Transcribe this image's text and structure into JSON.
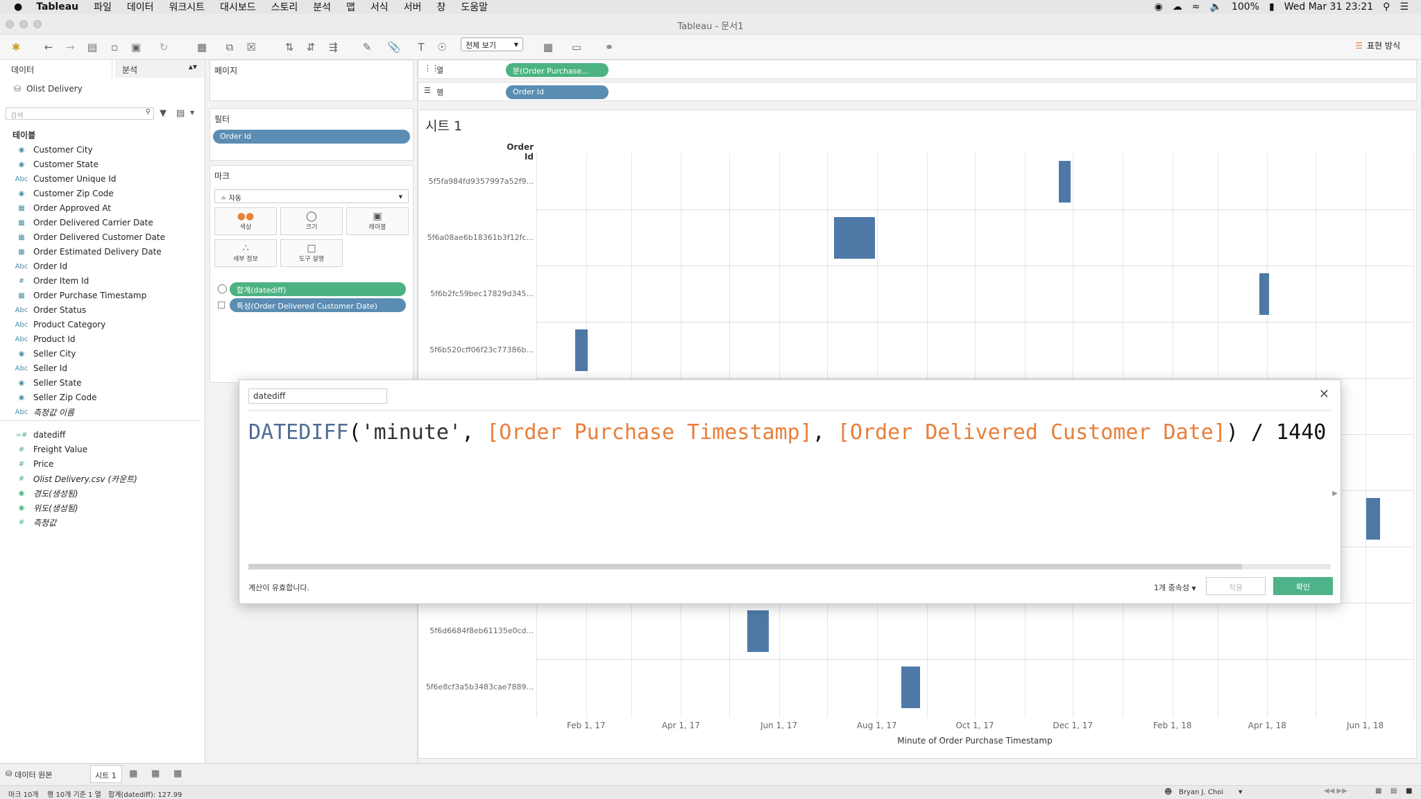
{
  "menubar": {
    "app": "Tableau",
    "items": [
      "파일",
      "데이터",
      "워크시트",
      "대시보드",
      "스토리",
      "분석",
      "맵",
      "서식",
      "서버",
      "창",
      "도움말"
    ],
    "battery": "100%",
    "datetime": "Wed Mar 31  23:21"
  },
  "window": {
    "title": "Tableau - 문서1"
  },
  "toolbar": {
    "view_mode": "전체 보기",
    "show_me": "표현 방식"
  },
  "data_pane": {
    "tab_data": "데이터",
    "tab_analysis": "분석",
    "datasource": "Olist Delivery",
    "search_placeholder": "검색",
    "section": "테이블",
    "dimensions": [
      {
        "icon": "globe",
        "name": "Customer City"
      },
      {
        "icon": "globe",
        "name": "Customer State"
      },
      {
        "icon": "abc",
        "name": "Customer Unique Id"
      },
      {
        "icon": "globe",
        "name": "Customer Zip Code"
      },
      {
        "icon": "date",
        "name": "Order Approved At"
      },
      {
        "icon": "date",
        "name": "Order Delivered Carrier Date"
      },
      {
        "icon": "date",
        "name": "Order Delivered Customer Date"
      },
      {
        "icon": "date",
        "name": "Order Estimated Delivery Date"
      },
      {
        "icon": "abc",
        "name": "Order Id"
      },
      {
        "icon": "hash",
        "name": "Order Item Id"
      },
      {
        "icon": "date",
        "name": "Order Purchase Timestamp"
      },
      {
        "icon": "abc",
        "name": "Order Status"
      },
      {
        "icon": "abc",
        "name": "Product Category"
      },
      {
        "icon": "abc",
        "name": "Product Id"
      },
      {
        "icon": "globe",
        "name": "Seller City"
      },
      {
        "icon": "abc",
        "name": "Seller Id"
      },
      {
        "icon": "globe",
        "name": "Seller State"
      },
      {
        "icon": "globe",
        "name": "Seller Zip Code"
      },
      {
        "icon": "abc",
        "name": "측정값 이름",
        "italic": true
      }
    ],
    "measures": [
      {
        "icon": "calc",
        "name": "datediff"
      },
      {
        "icon": "hash",
        "name": "Freight Value"
      },
      {
        "icon": "hash",
        "name": "Price"
      },
      {
        "icon": "hash",
        "name": "Olist Delivery.csv (카운트)",
        "italic": true
      },
      {
        "icon": "globe",
        "name": "경도(생성됨)",
        "italic": true
      },
      {
        "icon": "globe",
        "name": "위도(생성됨)",
        "italic": true
      },
      {
        "icon": "hash",
        "name": "측정값",
        "italic": true
      }
    ]
  },
  "shelves": {
    "pages_title": "페이지",
    "filters_title": "필터",
    "filter_pill": "Order Id",
    "marks_title": "마크",
    "marks_type": "자동",
    "mark_buttons": [
      "색상",
      "크기",
      "레이블",
      "세부 정보",
      "도구 설명"
    ],
    "mark_pills": [
      "합계(datediff)",
      "특성(Order Delivered Customer Date)"
    ],
    "columns_label": "열",
    "columns_pill": "분(Order Purchase...",
    "rows_label": "행",
    "rows_pill": "Order Id"
  },
  "sheet": {
    "title": "시트 1",
    "row_header": "Order Id",
    "x_axis_title": "Minute of Order Purchase Timestamp",
    "x_ticks": [
      "Feb 1, 17",
      "Apr 1, 17",
      "Jun 1, 17",
      "Aug 1, 17",
      "Oct 1, 17",
      "Dec 1, 17",
      "Feb 1, 18",
      "Apr 1, 18",
      "Jun 1, 18"
    ]
  },
  "chart_data": {
    "type": "bar",
    "xlabel": "Minute of Order Purchase Timestamp",
    "ylabel": "Order Id",
    "rows": [
      {
        "order_id": "5f5fa984fd9357997a52f9...",
        "purchase_date": "2017-11-26",
        "datediff_days": 7.2
      },
      {
        "order_id": "5f6a08ae6b18361b3f12fc...",
        "purchase_date": "2017-07-18",
        "datediff_days": 25
      },
      {
        "order_id": "5f6b2fc59bec17829d345...",
        "purchase_date": "2018-03-30",
        "datediff_days": 6.1
      },
      {
        "order_id": "5f6b520cff06f23c77386b...",
        "purchase_date": "2017-01-29",
        "datediff_days": 7.5
      },
      {
        "order_id": "5f6d6684f8eb61135e0cd...",
        "purchase_date": "2017-05-19",
        "datediff_days": 13.4
      },
      {
        "order_id": "5f6e8cf3a5b3483cae7889...",
        "purchase_date": "2017-08-22",
        "datediff_days": 11.8
      }
    ],
    "hidden_row_bar": {
      "purchase_date": "2018-06-06",
      "datediff_days": 8.5
    },
    "mark_color": "#4e79a7"
  },
  "calc_dialog": {
    "name": "datediff",
    "formula_parts": [
      {
        "t": "kw",
        "v": "DATEDIFF"
      },
      {
        "t": "p",
        "v": "("
      },
      {
        "t": "str",
        "v": "'minute'"
      },
      {
        "t": "p",
        "v": ", "
      },
      {
        "t": "fld",
        "v": "[Order Purchase Timestamp]"
      },
      {
        "t": "p",
        "v": ", "
      },
      {
        "t": "fld",
        "v": "[Order Delivered Customer Date]"
      },
      {
        "t": "p",
        "v": ") / 1440"
      }
    ],
    "validity": "계산이 유효합니다.",
    "dependencies": "1개 종속성",
    "apply": "적용",
    "ok": "확인"
  },
  "tabs": {
    "datasource": "데이터 원본",
    "sheet": "시트 1"
  },
  "status": {
    "marks": "마크 10개",
    "dims": "행 10개 기준 1 열",
    "sum": "합계(datediff): 127.99",
    "user": "Bryan J. Choi"
  }
}
